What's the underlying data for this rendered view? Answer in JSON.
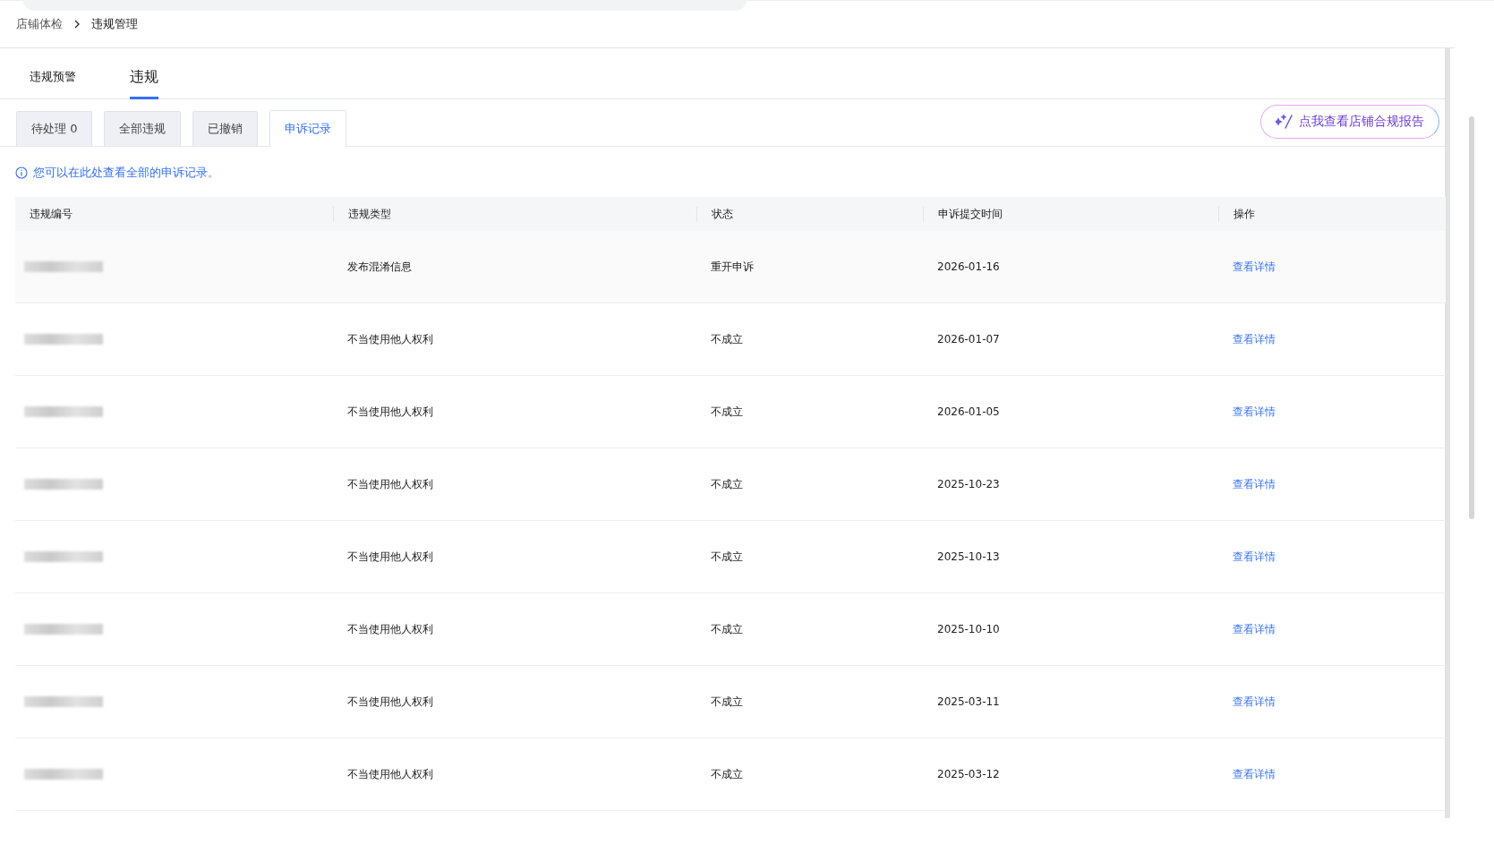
{
  "breadcrumb": [
    {
      "label": "店铺体检"
    },
    {
      "label": "违规管理"
    }
  ],
  "tabs": [
    {
      "label": "违规预警",
      "selected": false
    },
    {
      "label": "违规",
      "selected": true
    }
  ],
  "sub_tabs": [
    {
      "label": "待处理 0",
      "selected": false
    },
    {
      "label": "全部违规",
      "selected": false
    },
    {
      "label": "已撤销",
      "selected": false
    },
    {
      "label": "申诉记录",
      "selected": true
    }
  ],
  "report_button": "点我查看店铺合规报告",
  "info": "您可以在此处查看全部的申诉记录。",
  "table": {
    "columns": [
      "违规编号",
      "违规类型",
      "状态",
      "申诉提交时间",
      "操作"
    ],
    "rows": [
      {
        "type": "发布混淆信息",
        "status": "重开申诉",
        "time": "2026-01-16",
        "action": "查看详情",
        "hovered": true
      },
      {
        "type": "不当使用他人权利",
        "status": "不成立",
        "time": "2026-01-07",
        "action": "查看详情",
        "hovered": false
      },
      {
        "type": "不当使用他人权利",
        "status": "不成立",
        "time": "2026-01-05",
        "action": "查看详情",
        "hovered": false
      },
      {
        "type": "不当使用他人权利",
        "status": "不成立",
        "time": "2025-10-23",
        "action": "查看详情",
        "hovered": false
      },
      {
        "type": "不当使用他人权利",
        "status": "不成立",
        "time": "2025-10-13",
        "action": "查看详情",
        "hovered": false
      },
      {
        "type": "不当使用他人权利",
        "status": "不成立",
        "time": "2025-10-10",
        "action": "查看详情",
        "hovered": false
      },
      {
        "type": "不当使用他人权利",
        "status": "不成立",
        "time": "2025-03-11",
        "action": "查看详情",
        "hovered": false
      },
      {
        "type": "不当使用他人权利",
        "status": "不成立",
        "time": "2025-03-12",
        "action": "查看详情",
        "hovered": false
      }
    ]
  }
}
